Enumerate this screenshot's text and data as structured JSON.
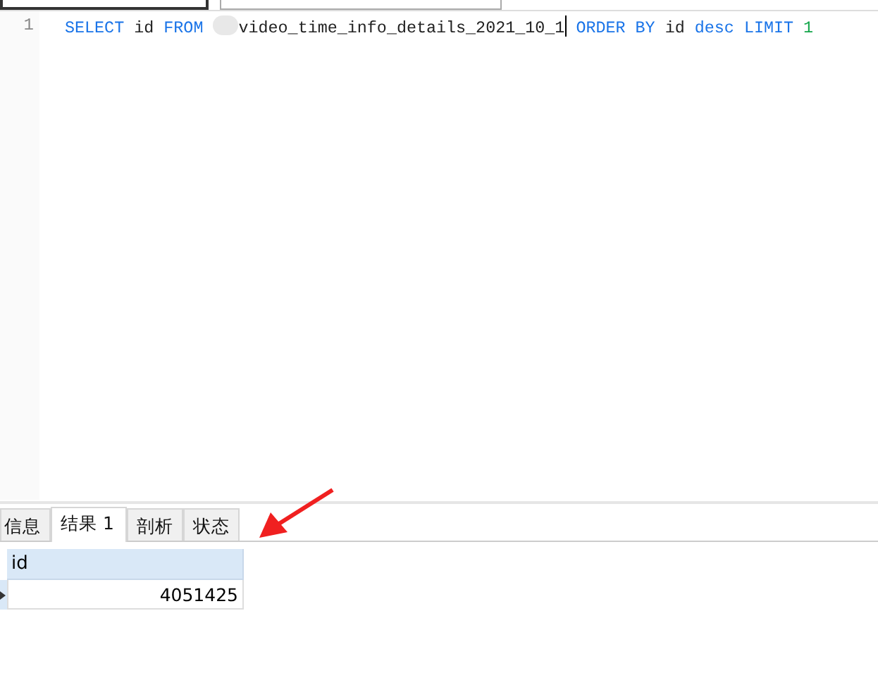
{
  "editor": {
    "lines": [
      {
        "number": "1",
        "tokens": [
          {
            "kind": "keyword",
            "text": "SELECT"
          },
          {
            "kind": "plain",
            "text": "id"
          },
          {
            "kind": "keyword",
            "text": "FROM"
          },
          {
            "kind": "redacted"
          },
          {
            "kind": "plain",
            "text": "video_time_info_details_2021_10_1"
          },
          {
            "kind": "cursor"
          },
          {
            "kind": "keyword",
            "text": "ORDER BY"
          },
          {
            "kind": "plain",
            "text": "id"
          },
          {
            "kind": "keyword",
            "text": "desc"
          },
          {
            "kind": "keyword",
            "text": "LIMIT"
          },
          {
            "kind": "number",
            "text": "1"
          }
        ]
      }
    ]
  },
  "result_tabs": [
    {
      "label": "信息",
      "selected": false
    },
    {
      "label": "结果 1",
      "selected": true
    },
    {
      "label": "剖析",
      "selected": false
    },
    {
      "label": "状态",
      "selected": false
    }
  ],
  "result_table": {
    "columns": [
      "id"
    ],
    "rows": [
      {
        "cells": [
          "4051425"
        ],
        "selected": true
      }
    ]
  }
}
